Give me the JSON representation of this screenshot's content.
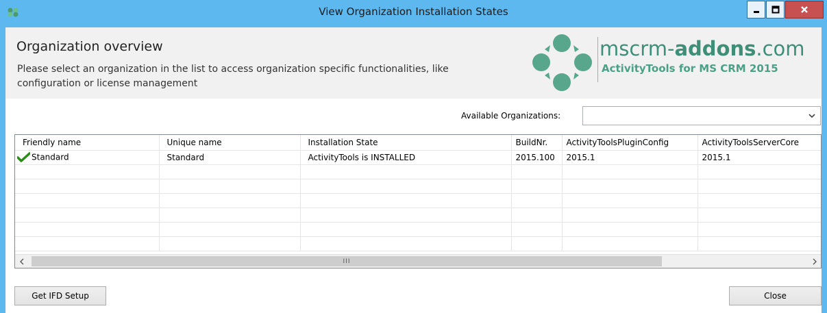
{
  "window": {
    "title": "View Organization Installation States",
    "icons": {
      "app": "app-logo-icon",
      "minimize": "minimize-icon",
      "maximize": "maximize-icon",
      "close": "close-icon"
    }
  },
  "header": {
    "title": "Organization overview",
    "description": "Please select an organization in the list to access organization specific functionalities, like configuration or license management",
    "logo": {
      "brand_prefix": "mscrm-",
      "brand_bold": "addons",
      "brand_suffix": ".com",
      "subtitle": "ActivityTools for MS CRM 2015"
    }
  },
  "organizations": {
    "label": "Available Organizations:",
    "selected": ""
  },
  "grid": {
    "columns": [
      "Friendly name",
      "Unique name",
      "Installation State",
      "BuildNr.",
      "ActivityToolsPluginConfig",
      "ActivityToolsServerCore"
    ],
    "rows": [
      {
        "friendly_name": "Standard",
        "unique_name": "Standard",
        "installation_state": "ActivityTools is INSTALLED",
        "build_nr": "2015.100",
        "plugin_config": "2015.1",
        "server_core": "2015.1",
        "status_icon": "check-icon"
      }
    ]
  },
  "buttons": {
    "get_ifd_setup": "Get IFD Setup",
    "close": "Close"
  },
  "colors": {
    "titlebar": "#5cb8ee",
    "brand_green": "#3f8f78",
    "close_button": "#c75050"
  }
}
